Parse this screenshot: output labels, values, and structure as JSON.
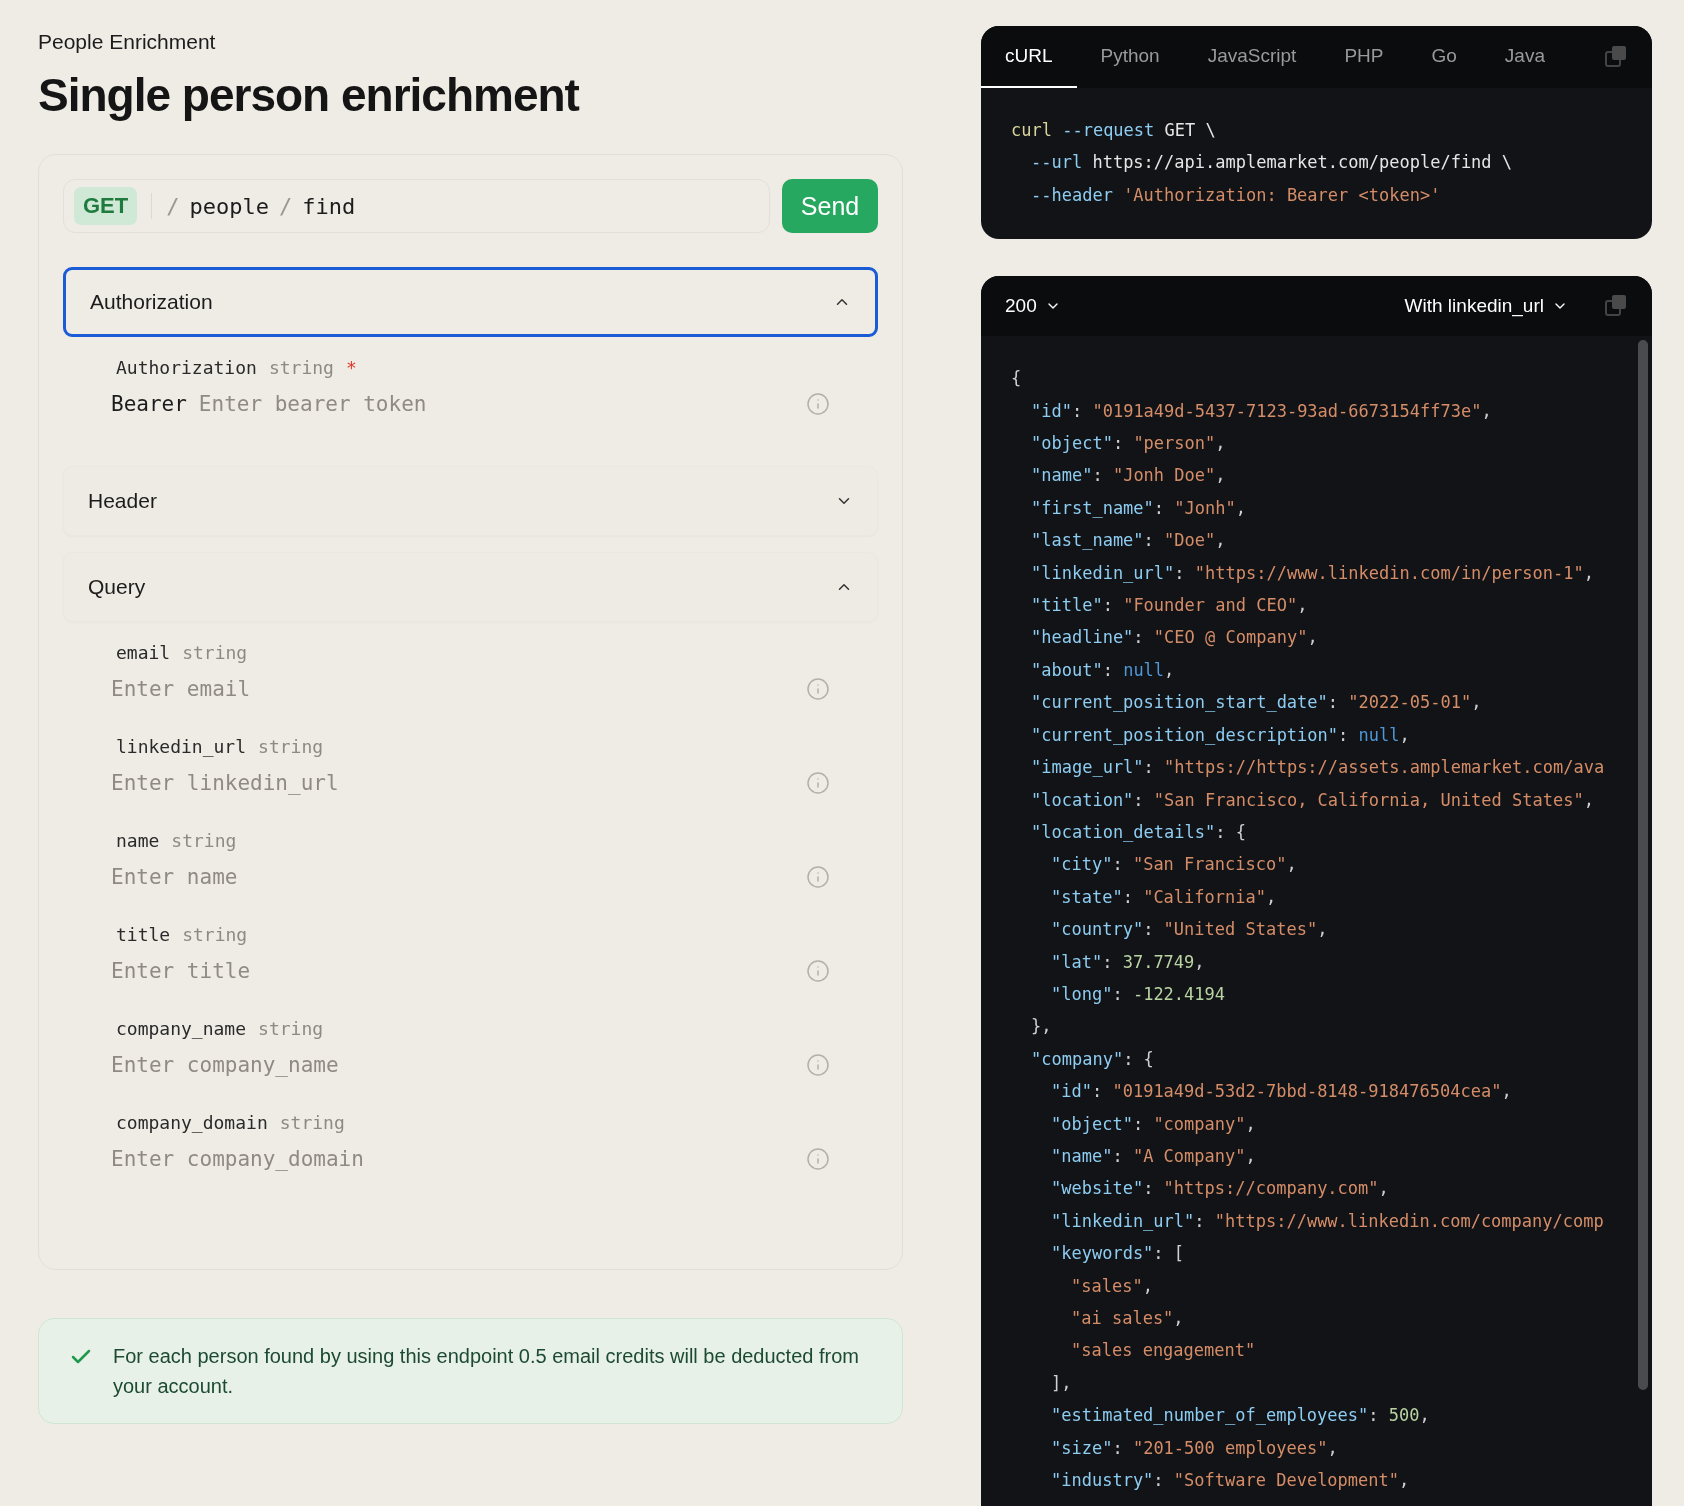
{
  "breadcrumb": "People Enrichment",
  "title": "Single person enrichment",
  "request": {
    "method": "GET",
    "path": [
      {
        "kind": "separator",
        "text": "/"
      },
      {
        "kind": "segment",
        "text": "people"
      },
      {
        "kind": "separator",
        "text": "/"
      },
      {
        "kind": "segment",
        "text": "find"
      }
    ],
    "send": "Send"
  },
  "sections": [
    {
      "title": "Authorization",
      "expanded": true,
      "focused": true,
      "fields": [
        {
          "name": "Authorization",
          "type": "string",
          "required_mark": "*",
          "prefix": "Bearer",
          "placeholder": "Enter bearer token"
        }
      ]
    },
    {
      "title": "Header",
      "expanded": false,
      "focused": false
    },
    {
      "title": "Query",
      "expanded": true,
      "focused": false,
      "fields": [
        {
          "name": "email",
          "type": "string",
          "placeholder": "Enter email"
        },
        {
          "name": "linkedin_url",
          "type": "string",
          "placeholder": "Enter linkedin_url"
        },
        {
          "name": "name",
          "type": "string",
          "placeholder": "Enter name"
        },
        {
          "name": "title",
          "type": "string",
          "placeholder": "Enter title"
        },
        {
          "name": "company_name",
          "type": "string",
          "placeholder": "Enter company_name"
        },
        {
          "name": "company_domain",
          "type": "string",
          "placeholder": "Enter company_domain"
        }
      ]
    }
  ],
  "notice": "For each person found by using this endpoint 0.5 email credits will be deducted from your account.",
  "snippet": {
    "tabs": [
      {
        "label": "cURL",
        "selected": true
      },
      {
        "label": "Python",
        "selected": false
      },
      {
        "label": "JavaScript",
        "selected": false
      },
      {
        "label": "PHP",
        "selected": false
      },
      {
        "label": "Go",
        "selected": false
      },
      {
        "label": "Java",
        "selected": false
      }
    ],
    "lines": [
      {
        "tokens": [
          {
            "kind": "command",
            "text": "curl"
          },
          {
            "kind": "flag",
            "text": " --request"
          },
          {
            "kind": "plain",
            "text": " GET \\"
          }
        ],
        "children": [
          {
            "tokens": [
              {
                "kind": "flag",
                "text": "--url"
              },
              {
                "kind": "plain",
                "text": " https://api.amplemarket.com/people/find \\"
              }
            ]
          },
          {
            "tokens": [
              {
                "kind": "flag",
                "text": "--header"
              },
              {
                "kind": "string",
                "text": " 'Authorization: Bearer <token>'"
              }
            ]
          }
        ]
      }
    ]
  },
  "response": {
    "status": "200",
    "example": "With linkedin_url",
    "lines": [
      {
        "tokens": [
          {
            "kind": "punct",
            "text": "{"
          }
        ],
        "children": [
          {
            "tokens": [
              {
                "kind": "key",
                "text": "\"id\""
              },
              {
                "kind": "punct",
                "text": ": "
              },
              {
                "kind": "string",
                "text": "\"0191a49d-5437-7123-93ad-6673154ff73e\""
              },
              {
                "kind": "punct",
                "text": ","
              }
            ]
          },
          {
            "tokens": [
              {
                "kind": "key",
                "text": "\"object\""
              },
              {
                "kind": "punct",
                "text": ": "
              },
              {
                "kind": "string",
                "text": "\"person\""
              },
              {
                "kind": "punct",
                "text": ","
              }
            ]
          },
          {
            "tokens": [
              {
                "kind": "key",
                "text": "\"name\""
              },
              {
                "kind": "punct",
                "text": ": "
              },
              {
                "kind": "string",
                "text": "\"Jonh Doe\""
              },
              {
                "kind": "punct",
                "text": ","
              }
            ]
          },
          {
            "tokens": [
              {
                "kind": "key",
                "text": "\"first_name\""
              },
              {
                "kind": "punct",
                "text": ": "
              },
              {
                "kind": "string",
                "text": "\"Jonh\""
              },
              {
                "kind": "punct",
                "text": ","
              }
            ]
          },
          {
            "tokens": [
              {
                "kind": "key",
                "text": "\"last_name\""
              },
              {
                "kind": "punct",
                "text": ": "
              },
              {
                "kind": "string",
                "text": "\"Doe\""
              },
              {
                "kind": "punct",
                "text": ","
              }
            ]
          },
          {
            "tokens": [
              {
                "kind": "key",
                "text": "\"linkedin_url\""
              },
              {
                "kind": "punct",
                "text": ": "
              },
              {
                "kind": "string",
                "text": "\"https://www.linkedin.com/in/person-1\""
              },
              {
                "kind": "punct",
                "text": ","
              }
            ]
          },
          {
            "tokens": [
              {
                "kind": "key",
                "text": "\"title\""
              },
              {
                "kind": "punct",
                "text": ": "
              },
              {
                "kind": "string",
                "text": "\"Founder and CEO\""
              },
              {
                "kind": "punct",
                "text": ","
              }
            ]
          },
          {
            "tokens": [
              {
                "kind": "key",
                "text": "\"headline\""
              },
              {
                "kind": "punct",
                "text": ": "
              },
              {
                "kind": "string",
                "text": "\"CEO @ Company\""
              },
              {
                "kind": "punct",
                "text": ","
              }
            ]
          },
          {
            "tokens": [
              {
                "kind": "key",
                "text": "\"about\""
              },
              {
                "kind": "punct",
                "text": ": "
              },
              {
                "kind": "null",
                "text": "null"
              },
              {
                "kind": "punct",
                "text": ","
              }
            ]
          },
          {
            "tokens": [
              {
                "kind": "key",
                "text": "\"current_position_start_date\""
              },
              {
                "kind": "punct",
                "text": ": "
              },
              {
                "kind": "string",
                "text": "\"2022-05-01\""
              },
              {
                "kind": "punct",
                "text": ","
              }
            ]
          },
          {
            "tokens": [
              {
                "kind": "key",
                "text": "\"current_position_description\""
              },
              {
                "kind": "punct",
                "text": ": "
              },
              {
                "kind": "null",
                "text": "null"
              },
              {
                "kind": "punct",
                "text": ","
              }
            ]
          },
          {
            "tokens": [
              {
                "kind": "key",
                "text": "\"image_url\""
              },
              {
                "kind": "punct",
                "text": ": "
              },
              {
                "kind": "string",
                "text": "\"https://https://assets.amplemarket.com/ava"
              }
            ]
          },
          {
            "tokens": [
              {
                "kind": "key",
                "text": "\"location\""
              },
              {
                "kind": "punct",
                "text": ": "
              },
              {
                "kind": "string",
                "text": "\"San Francisco, California, United States\""
              },
              {
                "kind": "punct",
                "text": ","
              }
            ]
          },
          {
            "tokens": [
              {
                "kind": "key",
                "text": "\"location_details\""
              },
              {
                "kind": "punct",
                "text": ": {"
              }
            ],
            "children": [
              {
                "tokens": [
                  {
                    "kind": "key",
                    "text": "\"city\""
                  },
                  {
                    "kind": "punct",
                    "text": ": "
                  },
                  {
                    "kind": "string",
                    "text": "\"San Francisco\""
                  },
                  {
                    "kind": "punct",
                    "text": ","
                  }
                ]
              },
              {
                "tokens": [
                  {
                    "kind": "key",
                    "text": "\"state\""
                  },
                  {
                    "kind": "punct",
                    "text": ": "
                  },
                  {
                    "kind": "string",
                    "text": "\"California\""
                  },
                  {
                    "kind": "punct",
                    "text": ","
                  }
                ]
              },
              {
                "tokens": [
                  {
                    "kind": "key",
                    "text": "\"country\""
                  },
                  {
                    "kind": "punct",
                    "text": ": "
                  },
                  {
                    "kind": "string",
                    "text": "\"United States\""
                  },
                  {
                    "kind": "punct",
                    "text": ","
                  }
                ]
              },
              {
                "tokens": [
                  {
                    "kind": "key",
                    "text": "\"lat\""
                  },
                  {
                    "kind": "punct",
                    "text": ": "
                  },
                  {
                    "kind": "number",
                    "text": "37.7749"
                  },
                  {
                    "kind": "punct",
                    "text": ","
                  }
                ]
              },
              {
                "tokens": [
                  {
                    "kind": "key",
                    "text": "\"long\""
                  },
                  {
                    "kind": "punct",
                    "text": ": "
                  },
                  {
                    "kind": "number",
                    "text": "-122.4194"
                  }
                ]
              }
            ]
          },
          {
            "tokens": [
              {
                "kind": "punct",
                "text": "},"
              }
            ]
          },
          {
            "tokens": [
              {
                "kind": "key",
                "text": "\"company\""
              },
              {
                "kind": "punct",
                "text": ": {"
              }
            ],
            "children": [
              {
                "tokens": [
                  {
                    "kind": "key",
                    "text": "\"id\""
                  },
                  {
                    "kind": "punct",
                    "text": ": "
                  },
                  {
                    "kind": "string",
                    "text": "\"0191a49d-53d2-7bbd-8148-918476504cea\""
                  },
                  {
                    "kind": "punct",
                    "text": ","
                  }
                ]
              },
              {
                "tokens": [
                  {
                    "kind": "key",
                    "text": "\"object\""
                  },
                  {
                    "kind": "punct",
                    "text": ": "
                  },
                  {
                    "kind": "string",
                    "text": "\"company\""
                  },
                  {
                    "kind": "punct",
                    "text": ","
                  }
                ]
              },
              {
                "tokens": [
                  {
                    "kind": "key",
                    "text": "\"name\""
                  },
                  {
                    "kind": "punct",
                    "text": ": "
                  },
                  {
                    "kind": "string",
                    "text": "\"A Company\""
                  },
                  {
                    "kind": "punct",
                    "text": ","
                  }
                ]
              },
              {
                "tokens": [
                  {
                    "kind": "key",
                    "text": "\"website\""
                  },
                  {
                    "kind": "punct",
                    "text": ": "
                  },
                  {
                    "kind": "string",
                    "text": "\"https://company.com\""
                  },
                  {
                    "kind": "punct",
                    "text": ","
                  }
                ]
              },
              {
                "tokens": [
                  {
                    "kind": "key",
                    "text": "\"linkedin_url\""
                  },
                  {
                    "kind": "punct",
                    "text": ": "
                  },
                  {
                    "kind": "string",
                    "text": "\"https://www.linkedin.com/company/comp"
                  }
                ]
              },
              {
                "tokens": [
                  {
                    "kind": "key",
                    "text": "\"keywords\""
                  },
                  {
                    "kind": "punct",
                    "text": ": ["
                  }
                ],
                "children": [
                  {
                    "tokens": [
                      {
                        "kind": "string",
                        "text": "\"sales\""
                      },
                      {
                        "kind": "punct",
                        "text": ","
                      }
                    ]
                  },
                  {
                    "tokens": [
                      {
                        "kind": "string",
                        "text": "\"ai sales\""
                      },
                      {
                        "kind": "punct",
                        "text": ","
                      }
                    ]
                  },
                  {
                    "tokens": [
                      {
                        "kind": "string",
                        "text": "\"sales engagement\""
                      }
                    ]
                  }
                ]
              },
              {
                "tokens": [
                  {
                    "kind": "punct",
                    "text": "],"
                  }
                ]
              },
              {
                "tokens": [
                  {
                    "kind": "key",
                    "text": "\"estimated_number_of_employees\""
                  },
                  {
                    "kind": "punct",
                    "text": ": "
                  },
                  {
                    "kind": "number",
                    "text": "500"
                  },
                  {
                    "kind": "punct",
                    "text": ","
                  }
                ]
              },
              {
                "tokens": [
                  {
                    "kind": "key",
                    "text": "\"size\""
                  },
                  {
                    "kind": "punct",
                    "text": ": "
                  },
                  {
                    "kind": "string",
                    "text": "\"201-500 employees\""
                  },
                  {
                    "kind": "punct",
                    "text": ","
                  }
                ]
              },
              {
                "tokens": [
                  {
                    "kind": "key",
                    "text": "\"industry\""
                  },
                  {
                    "kind": "punct",
                    "text": ": "
                  },
                  {
                    "kind": "string",
                    "text": "\"Software Development\""
                  },
                  {
                    "kind": "punct",
                    "text": ","
                  }
                ]
              }
            ]
          }
        ]
      }
    ]
  }
}
